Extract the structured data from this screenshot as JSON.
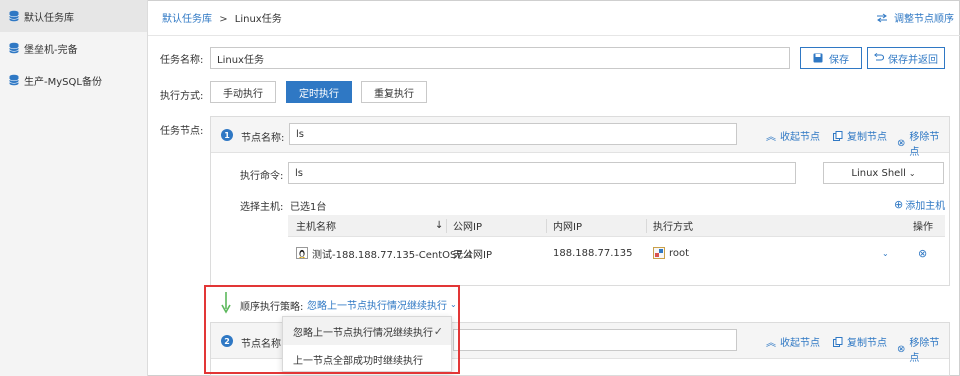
{
  "sidebar": {
    "items": [
      {
        "label": "默认任务库",
        "active": true
      },
      {
        "label": "堡垒机-完备",
        "active": false
      },
      {
        "label": "生产-MySQL备份",
        "active": false
      }
    ]
  },
  "header": {
    "breadcrumb_parent": "默认任务库",
    "breadcrumb_sep": ">",
    "breadcrumb_current": "Linux任务",
    "adjust_order_label": "调整节点顺序"
  },
  "form": {
    "task_name_label": "任务名称:",
    "task_name_value": "Linux任务",
    "save_label": "保存",
    "save_return_label": "保存并返回",
    "exec_mode_label": "执行方式:",
    "exec_modes": [
      "手动执行",
      "定时执行",
      "重复执行"
    ],
    "exec_mode_selected": "定时执行",
    "task_nodes_label": "任务节点:"
  },
  "node1": {
    "number": "1",
    "name_label": "节点名称:",
    "name_value": "ls",
    "collapse_label": "收起节点",
    "copy_label": "复制节点",
    "remove_label": "移除节点",
    "command_label": "执行命令:",
    "command_value": "ls",
    "shell_type": "Linux Shell",
    "host_label": "选择主机:",
    "host_selected_text": "已选1台",
    "add_host_label": "添加主机",
    "table": {
      "headers": [
        "主机名称",
        "公网IP",
        "内网IP",
        "执行方式",
        "操作"
      ],
      "rows": [
        {
          "host": "测试-188.188.77.135-CentOS7.4",
          "public_ip": "无公网IP",
          "private_ip": "188.188.77.135",
          "exec_user": "root"
        }
      ]
    }
  },
  "strategy": {
    "label": "顺序执行策略:",
    "selected": "忽略上一节点执行情况继续执行",
    "options": [
      "忽略上一节点执行情况继续执行",
      "上一节点全部成功时继续执行"
    ]
  },
  "node2": {
    "number": "2",
    "name_label": "节点名称",
    "collapse_label": "收起节点",
    "copy_label": "复制节点",
    "remove_label": "移除节点"
  },
  "colors": {
    "accent": "#2f78c4",
    "highlight_border": "#e23636",
    "arrow": "#5cb85c"
  }
}
